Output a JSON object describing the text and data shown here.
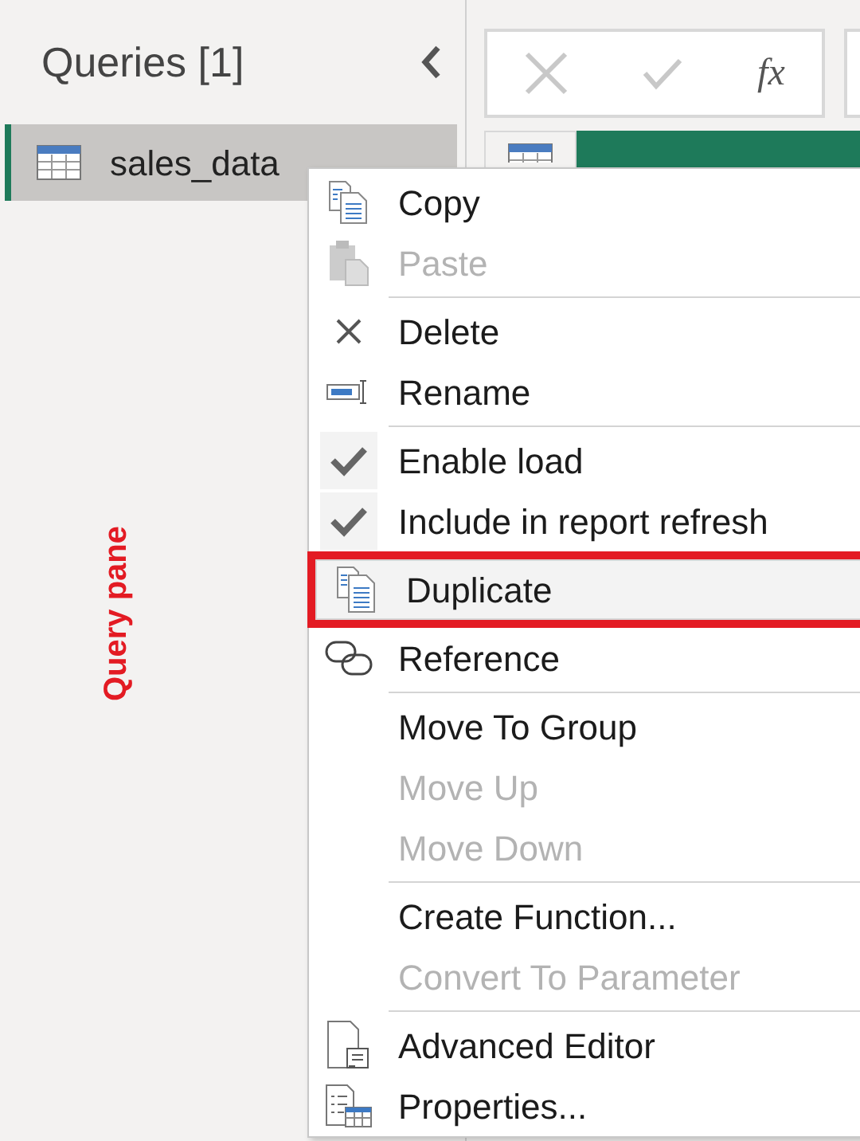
{
  "queries_pane": {
    "title": "Queries [1]",
    "items": [
      {
        "name": "sales_data",
        "selected": true
      }
    ],
    "annotation": "Query pane"
  },
  "formula_bar": {
    "fx": "fx"
  },
  "context_menu": {
    "groups": [
      [
        {
          "label": "Copy",
          "kind": "copy",
          "disabled": false
        },
        {
          "label": "Paste",
          "kind": "paste",
          "disabled": true
        }
      ],
      [
        {
          "label": "Delete",
          "kind": "delete",
          "disabled": false
        },
        {
          "label": "Rename",
          "kind": "rename",
          "disabled": false
        }
      ],
      [
        {
          "label": "Enable load",
          "kind": "check",
          "disabled": false,
          "checked": true
        },
        {
          "label": "Include in report refresh",
          "kind": "check",
          "disabled": false,
          "checked": true
        },
        {
          "label": "Duplicate",
          "kind": "duplicate",
          "disabled": false,
          "highlighted": true
        },
        {
          "label": "Reference",
          "kind": "reference",
          "disabled": false
        }
      ],
      [
        {
          "label": "Move To Group",
          "disabled": false
        },
        {
          "label": "Move Up",
          "disabled": true
        },
        {
          "label": "Move Down",
          "disabled": true
        }
      ],
      [
        {
          "label": "Create Function...",
          "disabled": false
        },
        {
          "label": "Convert To Parameter",
          "disabled": true
        }
      ],
      [
        {
          "label": "Advanced Editor",
          "kind": "editor",
          "disabled": false
        },
        {
          "label": "Properties...",
          "kind": "properties",
          "disabled": false
        }
      ]
    ]
  }
}
